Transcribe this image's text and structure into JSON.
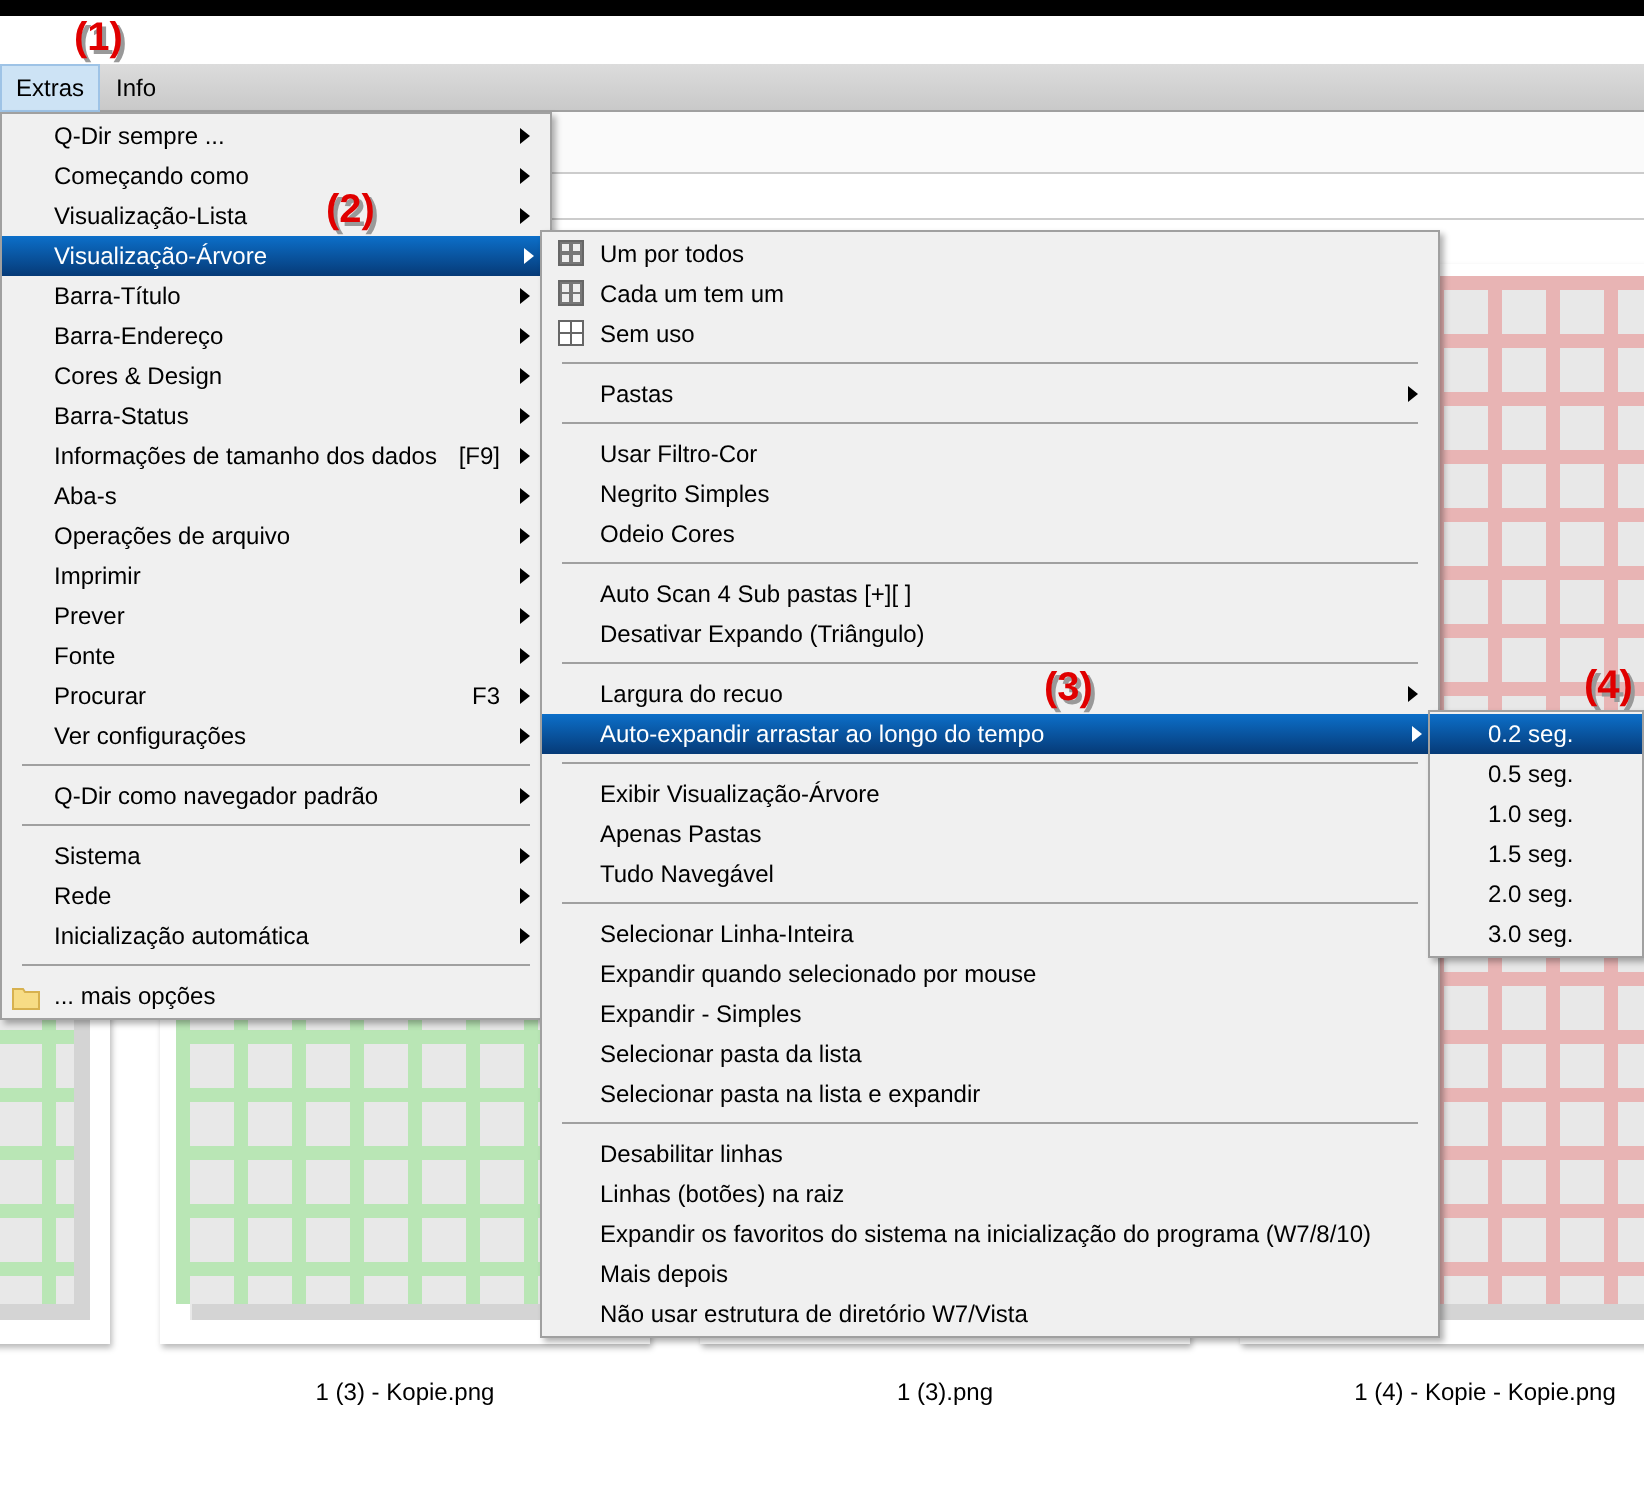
{
  "menubar": [
    {
      "label": "Extras",
      "selected": true
    },
    {
      "label": "Info",
      "selected": false
    }
  ],
  "annotations": [
    "(1)",
    "(4)"
  ],
  "main_menu": [
    {
      "kind": "item",
      "label": "Q-Dir sempre ...",
      "submenu": true,
      "selected": false
    },
    {
      "kind": "item",
      "label": "Começando como",
      "submenu": true,
      "selected": false
    },
    {
      "kind": "item",
      "label": "Visualização-Lista",
      "marker": "(2)",
      "submenu": true,
      "selected": false
    },
    {
      "kind": "item",
      "label": "Visualização-Árvore",
      "submenu": true,
      "selected": true
    },
    {
      "kind": "item",
      "label": "Barra-Título",
      "submenu": true,
      "selected": false
    },
    {
      "kind": "item",
      "label": "Barra-Endereço",
      "submenu": true,
      "selected": false
    },
    {
      "kind": "item",
      "label": "Cores & Design",
      "submenu": true,
      "selected": false
    },
    {
      "kind": "item",
      "label": "Barra-Status",
      "submenu": true,
      "selected": false
    },
    {
      "kind": "item",
      "label": "Informações de tamanho dos dados",
      "shortcut": "[F9]",
      "submenu": true,
      "selected": false
    },
    {
      "kind": "item",
      "label": "Aba-s",
      "submenu": true,
      "selected": false
    },
    {
      "kind": "item",
      "label": "Operações de arquivo",
      "submenu": true,
      "selected": false
    },
    {
      "kind": "item",
      "label": "Imprimir",
      "submenu": true,
      "selected": false
    },
    {
      "kind": "item",
      "label": "Prever",
      "submenu": true,
      "selected": false
    },
    {
      "kind": "item",
      "label": "Fonte",
      "submenu": true,
      "selected": false
    },
    {
      "kind": "item",
      "label": "Procurar",
      "shortcut": "F3",
      "submenu": true,
      "selected": false
    },
    {
      "kind": "item",
      "label": "Ver configurações",
      "submenu": true,
      "selected": false
    },
    {
      "kind": "separator"
    },
    {
      "kind": "item",
      "label": "Q-Dir como navegador padrão",
      "submenu": true,
      "selected": false
    },
    {
      "kind": "separator"
    },
    {
      "kind": "item",
      "label": "Sistema",
      "submenu": true,
      "selected": false
    },
    {
      "kind": "item",
      "label": "Rede",
      "submenu": true,
      "selected": false
    },
    {
      "kind": "item",
      "label": "Inicialização automática",
      "submenu": true,
      "selected": false
    },
    {
      "kind": "separator"
    },
    {
      "kind": "folder-item",
      "label": "... mais opções",
      "submenu": false,
      "selected": false
    }
  ],
  "tree_menu": [
    {
      "kind": "grid-full-item",
      "label": "Um por todos",
      "submenu": false,
      "selected": false
    },
    {
      "kind": "grid-split-item",
      "label": "Cada um tem um",
      "submenu": false,
      "selected": false
    },
    {
      "kind": "grid-empty-item",
      "label": "Sem uso",
      "submenu": false,
      "selected": false
    },
    {
      "kind": "separator"
    },
    {
      "kind": "item",
      "label": "Pastas",
      "submenu": true,
      "selected": false
    },
    {
      "kind": "separator"
    },
    {
      "kind": "item",
      "label": "Usar Filtro-Cor",
      "submenu": false,
      "selected": false
    },
    {
      "kind": "item",
      "label": "Negrito Simples",
      "submenu": false,
      "selected": false
    },
    {
      "kind": "item",
      "label": "Odeio Cores",
      "submenu": false,
      "selected": false
    },
    {
      "kind": "separator"
    },
    {
      "kind": "item",
      "label": "Auto Scan 4 Sub pastas [+][ ]",
      "submenu": false,
      "selected": false
    },
    {
      "kind": "item",
      "label": "Desativar Expando (Triângulo)",
      "submenu": false,
      "selected": false
    },
    {
      "kind": "separator"
    },
    {
      "kind": "item",
      "label": "Largura do recuo",
      "marker": "(3)",
      "submenu": true,
      "selected": false
    },
    {
      "kind": "item",
      "label": "Auto-expandir arrastar ao longo do tempo",
      "submenu": true,
      "selected": true
    },
    {
      "kind": "separator"
    },
    {
      "kind": "item",
      "label": "Exibir Visualização-Árvore",
      "submenu": false,
      "selected": false
    },
    {
      "kind": "item",
      "label": "Apenas Pastas",
      "submenu": false,
      "selected": false
    },
    {
      "kind": "item",
      "label": "Tudo Navegável",
      "submenu": false,
      "selected": false
    },
    {
      "kind": "separator"
    },
    {
      "kind": "item",
      "label": "Selecionar Linha-Inteira",
      "submenu": false,
      "selected": false
    },
    {
      "kind": "item",
      "label": "Expandir quando selecionado por mouse",
      "submenu": false,
      "selected": false
    },
    {
      "kind": "item",
      "label": "Expandir - Simples",
      "submenu": false,
      "selected": false
    },
    {
      "kind": "item",
      "label": "Selecionar pasta da lista",
      "submenu": false,
      "selected": false
    },
    {
      "kind": "item",
      "label": "Selecionar pasta na lista e expandir",
      "submenu": false,
      "selected": false
    },
    {
      "kind": "separator"
    },
    {
      "kind": "item",
      "label": "Desabilitar linhas",
      "submenu": false,
      "selected": false
    },
    {
      "kind": "item",
      "label": "Linhas (botões) na raiz",
      "submenu": false,
      "selected": false
    },
    {
      "kind": "item",
      "label": "Expandir os favoritos do sistema na inicialização do programa (W7/8/10)",
      "submenu": false,
      "selected": false
    },
    {
      "kind": "item",
      "label": "Mais depois",
      "submenu": false,
      "selected": false
    },
    {
      "kind": "item",
      "label": "Não usar estrutura de diretório W7/Vista",
      "submenu": false,
      "selected": false
    }
  ],
  "delay_menu": [
    {
      "kind": "item",
      "label": "0.2 seg.",
      "submenu": false,
      "selected": true
    },
    {
      "kind": "item",
      "label": "0.5 seg.",
      "submenu": false,
      "selected": false
    },
    {
      "kind": "item",
      "label": "1.0 seg.",
      "submenu": false,
      "selected": false
    },
    {
      "kind": "item",
      "label": "1.5 seg.",
      "submenu": false,
      "selected": false
    },
    {
      "kind": "item",
      "label": "2.0 seg.",
      "submenu": false,
      "selected": false
    },
    {
      "kind": "item",
      "label": "3.0 seg.",
      "submenu": false,
      "selected": false
    }
  ],
  "thumbnails": [
    {
      "color": "#b9e6b5"
    },
    {
      "caption": "1 (3) - Kopie.png",
      "color": "#b9e6b5"
    },
    {
      "caption": "1 (3).png"
    },
    {
      "caption": "1 (4) - Kopie - Kopie.png",
      "color": "#e8b4b4"
    }
  ]
}
